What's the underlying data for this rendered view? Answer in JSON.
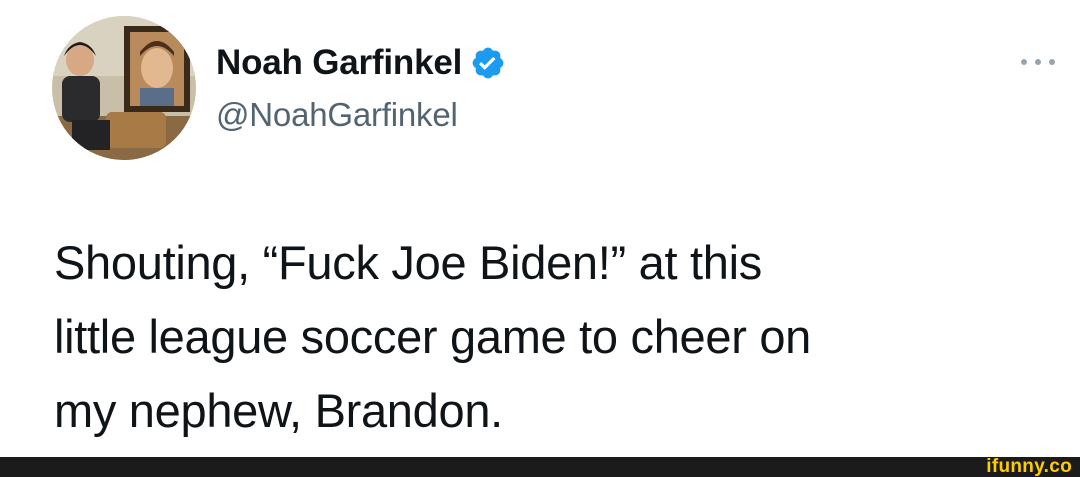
{
  "tweet": {
    "author": {
      "display_name": "Noah Garfinkel",
      "handle": "@NoahGarfinkel",
      "verified": true
    },
    "text": "Shouting, “Fuck Joe Biden!” at this\nlittle league soccer game to cheer on\nmy nephew, Brandon.",
    "more_icon": "more-horizontal-icon"
  },
  "colors": {
    "verified_badge": "#1d9bf0",
    "name_text": "#0f1419",
    "handle_text": "#536471",
    "watermark": "#ffcc00",
    "footer_bar": "#1b1b1b"
  },
  "watermark": {
    "text": "ifunny.co"
  }
}
